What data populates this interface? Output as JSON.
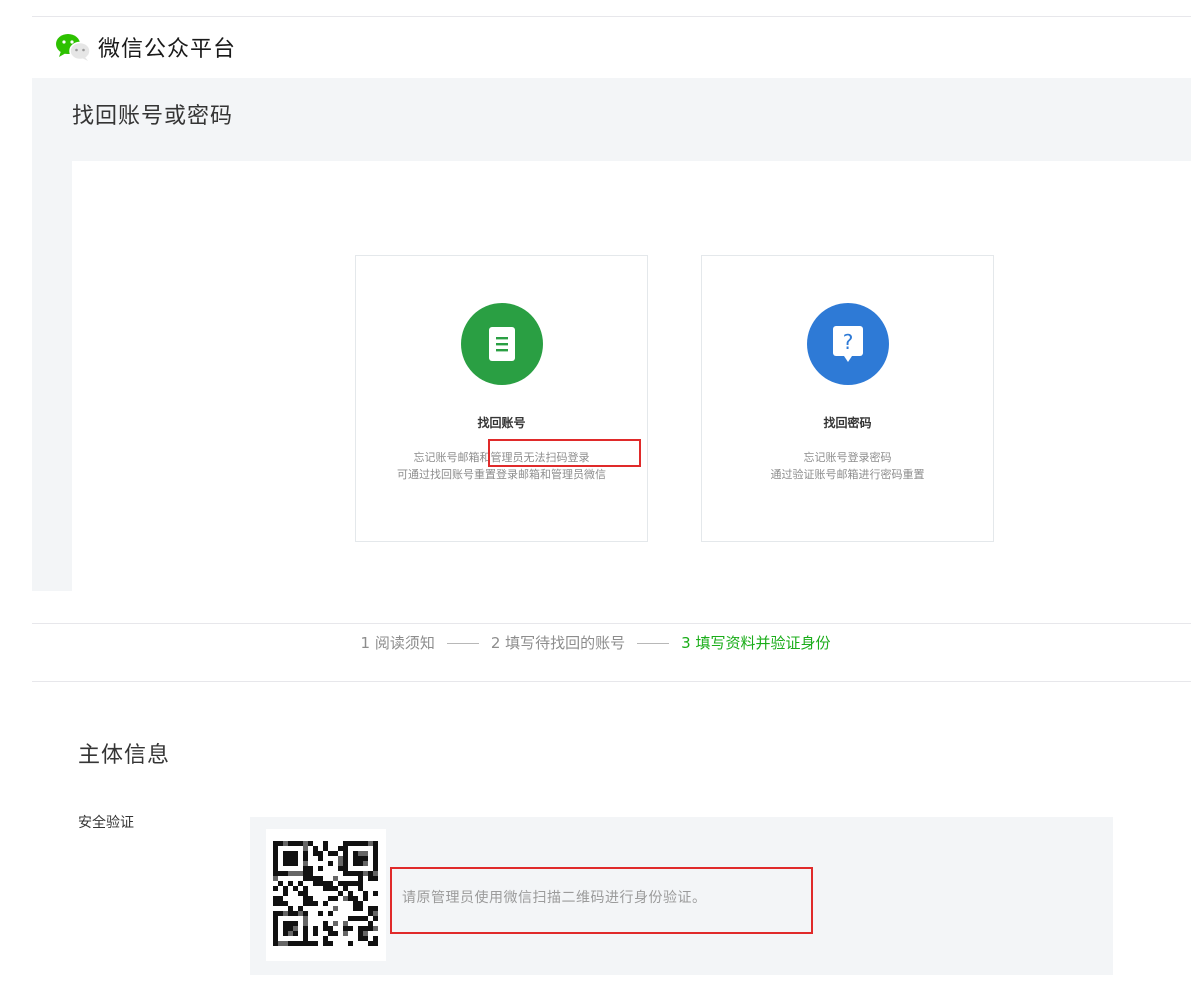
{
  "header": {
    "brand": "微信公众平台",
    "logo_icon": "wechat-logo-icon"
  },
  "recover": {
    "title": "找回账号或密码",
    "cards": [
      {
        "title": "找回账号",
        "desc_line1": "忘记账号邮箱和管理员无法扫码登录",
        "desc_line2": "可通过找回账号重置登录邮箱和管理员微信",
        "icon": "document-icon",
        "color": "#2a9f43"
      },
      {
        "title": "找回密码",
        "desc_line1": "忘记账号登录密码",
        "desc_line2": "通过验证账号邮箱进行密码重置",
        "icon": "question-bubble-icon",
        "color": "#2e7ad6"
      }
    ]
  },
  "steps": [
    {
      "label": "1 阅读须知",
      "active": false
    },
    {
      "label": "2 填写待找回的账号",
      "active": false
    },
    {
      "label": "3 填写资料并验证身份",
      "active": true
    }
  ],
  "subject": {
    "title": "主体信息",
    "security_label": "安全验证",
    "verify_text": "请原管理员使用微信扫描二维码进行身份验证。",
    "qr_icon": "qr-code-icon"
  },
  "colors": {
    "accent_green": "#1aad19",
    "highlight_red": "#e02a2a"
  }
}
